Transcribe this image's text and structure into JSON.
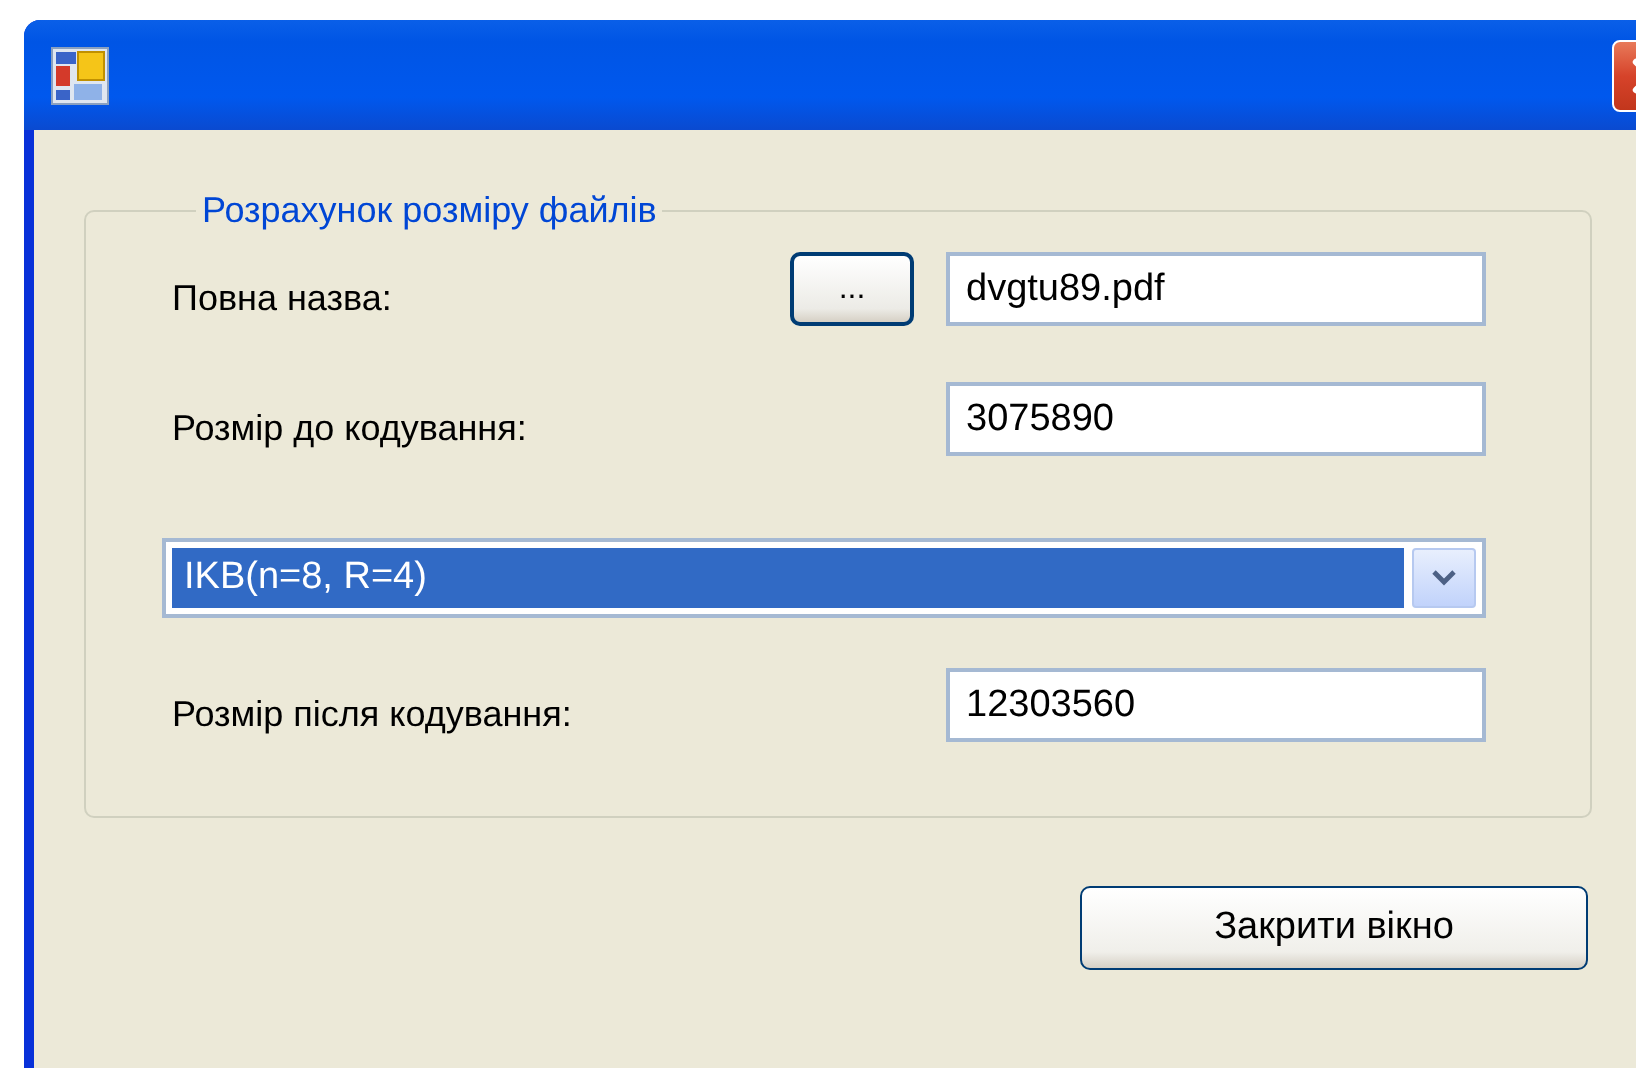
{
  "group": {
    "title": "Розрахунок розміру файлів",
    "rows": [
      {
        "kind": "field",
        "label": "Повна назва:",
        "browse": "...",
        "value": "dvgtu89.pdf"
      },
      {
        "kind": "field",
        "label": "Розмір до кодування:",
        "value": "3075890"
      },
      {
        "kind": "combo",
        "value": "IKB(n=8, R=4)",
        "focused": true
      },
      {
        "kind": "field",
        "label": "Розмір після кодування:",
        "value": "12303560"
      }
    ]
  },
  "buttons": [
    {
      "label": "Закрити вікно"
    }
  ]
}
